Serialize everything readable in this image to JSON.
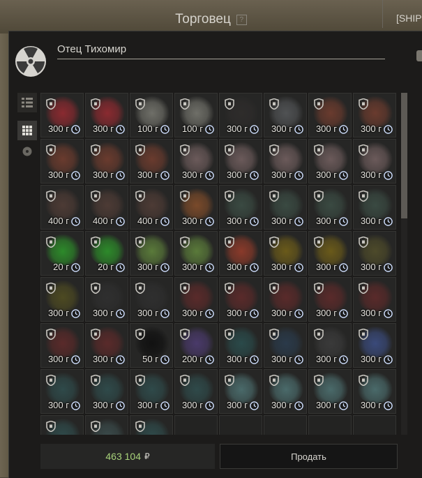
{
  "header": {
    "title": "Торговец",
    "help_label": "?",
    "right_tab": "[SHIP"
  },
  "trader": {
    "name": "Отец Тихомир"
  },
  "footer": {
    "amount": "463 104",
    "currency": "₽",
    "sell_label": "Продать"
  },
  "currency_suffix": "г",
  "items": [
    {
      "price": "300",
      "color": "#8a2a30"
    },
    {
      "price": "300",
      "color": "#8a2a30"
    },
    {
      "price": "100",
      "color": "#6f6f68"
    },
    {
      "price": "100",
      "color": "#6f6f68"
    },
    {
      "price": "300",
      "color": "#2e2c2b"
    },
    {
      "price": "300",
      "color": "#505254"
    },
    {
      "price": "300",
      "color": "#6a3b2e"
    },
    {
      "price": "300",
      "color": "#6a3b2e"
    },
    {
      "price": "300",
      "color": "#6a3b2e"
    },
    {
      "price": "300",
      "color": "#6a3b2e"
    },
    {
      "price": "300",
      "color": "#6a3b2e"
    },
    {
      "price": "300",
      "color": "#6b5a5a"
    },
    {
      "price": "300",
      "color": "#6b5a5a"
    },
    {
      "price": "300",
      "color": "#6b5a5a"
    },
    {
      "price": "300",
      "color": "#6b5a5a"
    },
    {
      "price": "300",
      "color": "#6b5a5a"
    },
    {
      "price": "400",
      "color": "#4d3b35"
    },
    {
      "price": "400",
      "color": "#4d3b35"
    },
    {
      "price": "400",
      "color": "#4d3b35"
    },
    {
      "price": "300",
      "color": "#7a4a2a"
    },
    {
      "price": "300",
      "color": "#3a4a42"
    },
    {
      "price": "300",
      "color": "#3a4a42"
    },
    {
      "price": "300",
      "color": "#3a4a42"
    },
    {
      "price": "300",
      "color": "#3a4a42"
    },
    {
      "price": "20",
      "color": "#2d8a2a"
    },
    {
      "price": "20",
      "color": "#2d8a2a"
    },
    {
      "price": "300",
      "color": "#5a7a3a"
    },
    {
      "price": "300",
      "color": "#5a7a3a"
    },
    {
      "price": "300",
      "color": "#8a3a2a"
    },
    {
      "price": "300",
      "color": "#6a5a1a"
    },
    {
      "price": "300",
      "color": "#6a5a1a"
    },
    {
      "price": "300",
      "color": "#4d4a2a"
    },
    {
      "price": "300",
      "color": "#4d4a22"
    },
    {
      "price": "300",
      "color": "#2f2f2f"
    },
    {
      "price": "300",
      "color": "#2f2f2f"
    },
    {
      "price": "300",
      "color": "#5a2a2a"
    },
    {
      "price": "300",
      "color": "#5a2a2a"
    },
    {
      "price": "300",
      "color": "#5a2a2a"
    },
    {
      "price": "300",
      "color": "#5a2a2a"
    },
    {
      "price": "300",
      "color": "#5a2a2a"
    },
    {
      "price": "300",
      "color": "#5a2a2a"
    },
    {
      "price": "300",
      "color": "#5a2a2a"
    },
    {
      "price": "50",
      "color": "#111111"
    },
    {
      "price": "200",
      "color": "#4a3a6a"
    },
    {
      "price": "300",
      "color": "#2a4a4a"
    },
    {
      "price": "300",
      "color": "#2a3a4a"
    },
    {
      "price": "300",
      "color": "#3a3a3a"
    },
    {
      "price": "300",
      "color": "#3a4a7a"
    },
    {
      "price": "300",
      "color": "#2f4a4a"
    },
    {
      "price": "300",
      "color": "#2f4a4a"
    },
    {
      "price": "300",
      "color": "#2f4a4a"
    },
    {
      "price": "300",
      "color": "#2f4a4a"
    },
    {
      "price": "300",
      "color": "#4a6a6a"
    },
    {
      "price": "300",
      "color": "#4a6a6a"
    },
    {
      "price": "300",
      "color": "#4a6a6a"
    },
    {
      "price": "300",
      "color": "#4a6a6a"
    },
    {
      "price": "",
      "color": "#2f4a4a"
    },
    {
      "price": "",
      "color": "#3a4a4a"
    },
    {
      "price": "",
      "color": "#2f4a4a"
    }
  ]
}
